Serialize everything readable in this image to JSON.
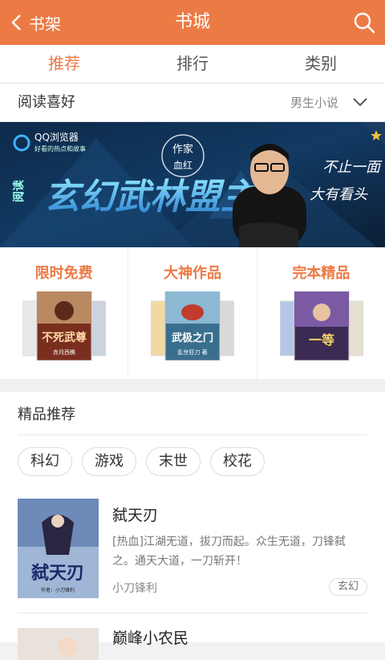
{
  "header": {
    "back_label": "书架",
    "title": "书城",
    "accent_color": "#ec7a45",
    "back_icon": "chevron-left-icon",
    "search_icon": "search-icon"
  },
  "tabs": [
    {
      "label": "推荐",
      "active": true
    },
    {
      "label": "排行",
      "active": false
    },
    {
      "label": "类别",
      "active": false
    }
  ],
  "preference": {
    "label": "阅读喜好",
    "value": "男生小说",
    "icon": "chevron-down-icon"
  },
  "banner": {
    "browser_name": "QQ浏览器",
    "browser_slogan": "好看的热点和故事",
    "author_tag": "作家",
    "author_name": "血红",
    "headline": "玄幻武林盟主",
    "side_text": "阅读",
    "slogan_line1": "不止一面",
    "slogan_line2": "大有看头"
  },
  "sections": [
    {
      "title": "限时免费",
      "cover_text": "不死武尊",
      "cover_sub": "赤月西樵"
    },
    {
      "title": "大神作品",
      "cover_text": "武极之门",
      "cover_sub": "乱世狂刀 著"
    },
    {
      "title": "完本精品",
      "cover_text": "一等",
      "cover_sub": ""
    }
  ],
  "recommend": {
    "title": "精品推荐",
    "chips": [
      "科幻",
      "游戏",
      "末世",
      "校花"
    ],
    "books": [
      {
        "name": "弑天刃",
        "description": "[热血]江湖无道，拔刀而起。众生无道，刀锋弑之。通天大道，一刀斩开！",
        "author": "小刀锋利",
        "tag": "玄幻",
        "cover_title": "弑天刃",
        "cover_author": "作者：小刀锋利"
      },
      {
        "name": "巅峰小农民"
      }
    ]
  }
}
